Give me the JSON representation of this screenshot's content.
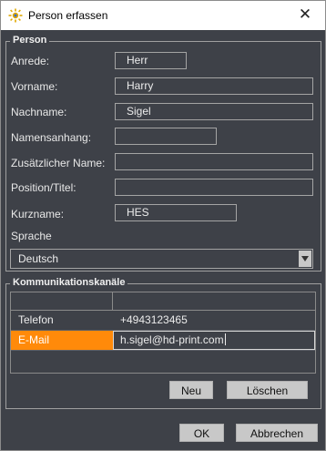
{
  "window": {
    "title": "Person erfassen",
    "close_glyph": "✕",
    "icon": "sun-gear-icon"
  },
  "person": {
    "legend": "Person",
    "anrede_label": "Anrede:",
    "anrede_value": "Herr",
    "vorname_label": "Vorname:",
    "vorname_value": "Harry",
    "nachname_label": "Nachname:",
    "nachname_value": "Sigel",
    "namensanhang_label": "Namensanhang:",
    "namensanhang_value": "",
    "zusatzname_label": "Zusätzlicher Name:",
    "zusatzname_value": "",
    "position_label": "Position/Titel:",
    "position_value": "",
    "kurzname_label": "Kurzname:",
    "kurzname_value": "HES",
    "sprache_label": "Sprache",
    "sprache_value": "Deutsch"
  },
  "kommunikation": {
    "legend": "Kommunikationskanäle",
    "rows": [
      {
        "type": "Telefon",
        "value": "+4943123465"
      },
      {
        "type": "E-Mail",
        "value": "h.sigel@hd-print.com"
      }
    ],
    "neu_label": "Neu",
    "loeschen_label": "Löschen"
  },
  "footer": {
    "ok_label": "OK",
    "abbrechen_label": "Abbrechen"
  },
  "colors": {
    "background": "#3e4148",
    "selection": "#ff8a0a",
    "button": "#c8c8c8"
  }
}
